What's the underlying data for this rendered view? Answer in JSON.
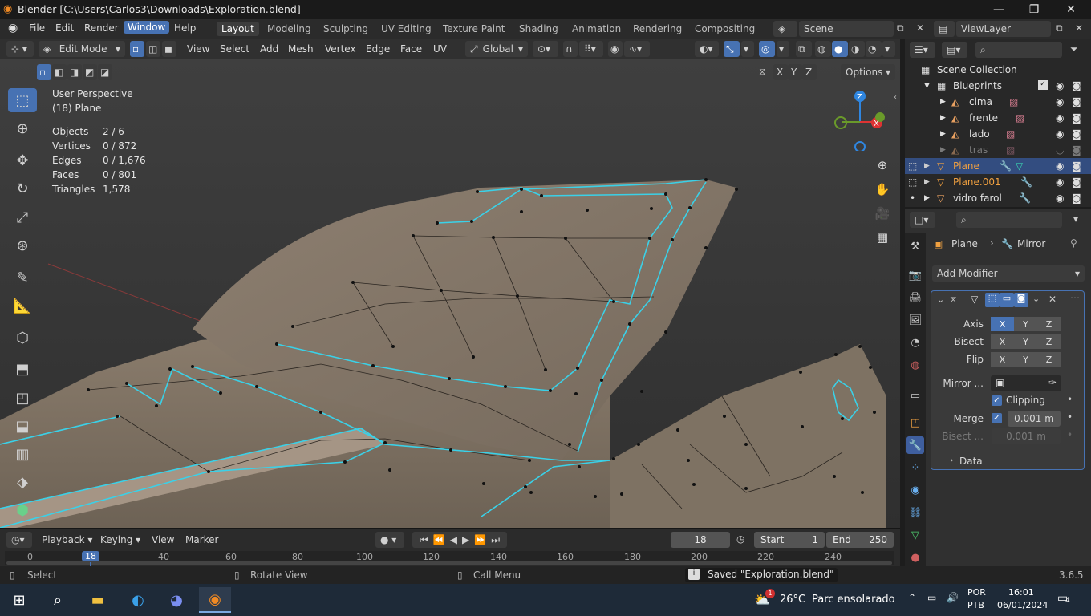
{
  "window": {
    "title": "Blender [C:\\Users\\Carlos3\\Downloads\\Exploration.blend]",
    "minimize": "—",
    "maximize": "❐",
    "close": "✕"
  },
  "menu": {
    "file": "File",
    "edit": "Edit",
    "render": "Render",
    "window": "Window",
    "help": "Help"
  },
  "workspaces": [
    "Layout",
    "Modeling",
    "Sculpting",
    "UV Editing",
    "Texture Paint",
    "Shading",
    "Animation",
    "Rendering",
    "Compositing"
  ],
  "scene": {
    "scene_name": "Scene",
    "view_layer": "ViewLayer"
  },
  "vp_header": {
    "mode": "Edit Mode",
    "view": "View",
    "select": "Select",
    "add": "Add",
    "mesh": "Mesh",
    "vertex": "Vertex",
    "edge": "Edge",
    "face": "Face",
    "uv": "UV",
    "orientation": "Global",
    "options": "Options",
    "axes": [
      "X",
      "Y",
      "Z"
    ]
  },
  "viewport": {
    "perspective": "User Perspective",
    "object": "(18) Plane",
    "stats": [
      {
        "label": "Objects",
        "value": "2 / 6"
      },
      {
        "label": "Vertices",
        "value": "0 / 872"
      },
      {
        "label": "Edges",
        "value": "0 / 1,676"
      },
      {
        "label": "Faces",
        "value": "0 / 801"
      },
      {
        "label": "Triangles",
        "value": "1,578"
      }
    ],
    "gizmo": {
      "z": "Z",
      "x": "X"
    }
  },
  "timeline": {
    "playback": "Playback",
    "keying": "Keying",
    "view": "View",
    "marker": "Marker",
    "current_frame": "18",
    "start_label": "Start",
    "start": "1",
    "end_label": "End",
    "end": "250",
    "ruler": [
      "0",
      "18",
      "40",
      "60",
      "80",
      "100",
      "120",
      "140",
      "160",
      "180",
      "200",
      "220",
      "240"
    ]
  },
  "statusbar": {
    "select": "Select",
    "rotate": "Rotate View",
    "menu": "Call Menu",
    "saved": "Saved \"Exploration.blend\"",
    "version": "3.6.5"
  },
  "outliner": {
    "root": "Scene Collection",
    "items": [
      {
        "name": "Blueprints"
      },
      {
        "name": "cima"
      },
      {
        "name": "frente"
      },
      {
        "name": "lado"
      },
      {
        "name": "tras"
      },
      {
        "name": "Plane"
      },
      {
        "name": "Plane.001"
      },
      {
        "name": "vidro farol"
      }
    ]
  },
  "properties": {
    "breadcrumb_object": "Plane",
    "breadcrumb_modifier": "Mirror",
    "add_modifier": "Add Modifier",
    "axis_label": "Axis",
    "bisect_label": "Bisect",
    "flip_label": "Flip",
    "mirror_object_label": "Mirror ...",
    "clipping_label": "Clipping",
    "merge_label": "Merge",
    "merge_value": "0.001 m",
    "bisect_dist_label": "Bisect ...",
    "bisect_dist_value": "0.001 m",
    "data_label": "Data"
  },
  "taskbar": {
    "weather_temp": "26°C",
    "weather_desc": "Parc ensolarado",
    "lang1": "POR",
    "lang2": "PTB",
    "time": "16:01",
    "date": "06/01/2024",
    "notif_count": "4",
    "weather_badge": "1"
  },
  "colors": {
    "accent": "#4772b3",
    "edge_highlight": "#3ad1e8",
    "mesh_surface": "#8a7b6a"
  }
}
